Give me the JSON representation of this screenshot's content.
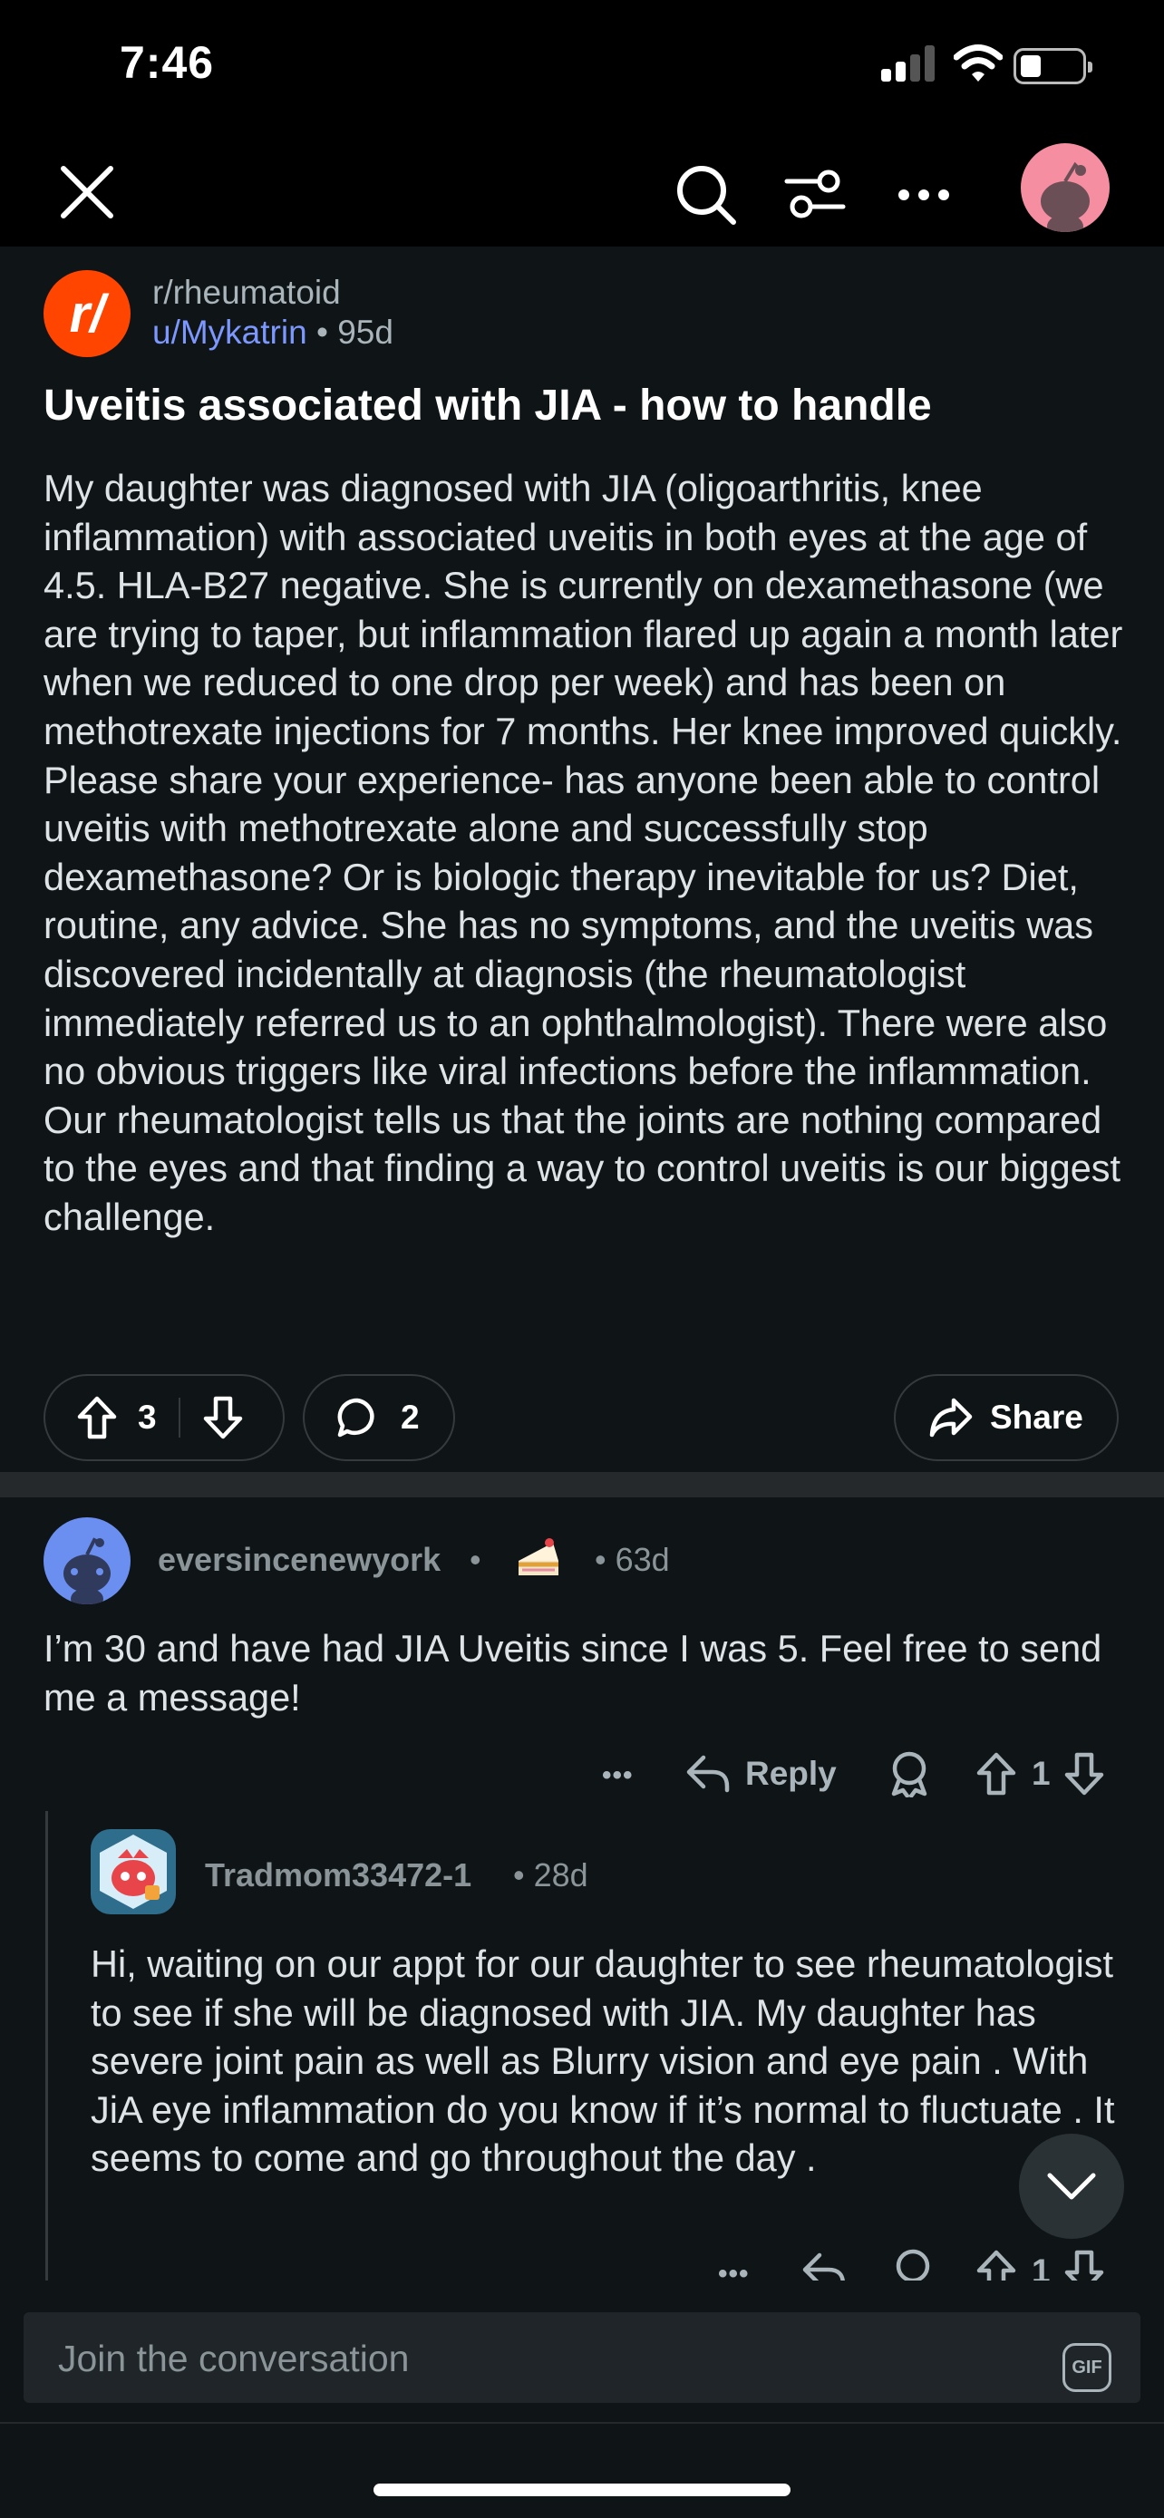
{
  "status_bar": {
    "time": "7:46"
  },
  "post": {
    "subreddit": "r/rheumatoid",
    "subreddit_icon": "r/",
    "author": "u/Mykatrin",
    "separator": "•",
    "age": "95d",
    "title": "Uveitis associated with JIA - how to handle",
    "body": "My daughter was diagnosed with JIA (oligoarthritis, knee inflammation) with associated uveitis in both eyes at the age of 4.5. HLA-B27 negative. She is currently on dexamethasone (we are trying to taper, but inflammation flared up again a month later when we reduced to one drop per week) and has been on methotrexate injections for 7 months. Her knee improved quickly. Please share your experience- has anyone been able to control uveitis with methotrexate alone and successfully stop dexamethasone? Or is biologic therapy inevitable for us? Diet, routine, any advice. She has no symptoms, and the uveitis was discovered incidentally at diagnosis (the rheumatologist immediately referred us to an ophthalmologist). There were also no obvious triggers like viral infections before the inflammation. Our rheumatologist tells us that the joints are nothing compared to the eyes and that finding a way to control uveitis is our biggest challenge.",
    "upvotes": "3",
    "comments": "2",
    "share_label": "Share"
  },
  "comments": [
    {
      "author": "eversincenewyork",
      "dot": "•",
      "age": "• 63d",
      "body": "I’m 30 and have had JIA Uveitis since I was 5. Feel free to send me a message!",
      "actions": {
        "more": "•••",
        "reply": "Reply",
        "votes": "1"
      }
    },
    {
      "author": "Tradmom33472-1",
      "age": "• 28d",
      "body": "Hi,  waiting on our appt for our daughter to see rheumatologist to see if she will be diagnosed with JIA. My daughter has severe joint pain as well as Blurry vision and eye pain . With JiA eye inflammation do you know if it’s normal to fluctuate . It seems to come and go throughout the day .",
      "actions": {
        "more": "•••",
        "votes": "1"
      }
    }
  ],
  "composer": {
    "placeholder": "Join the conversation",
    "gif_label": "GIF"
  },
  "icons": [
    "close-icon",
    "search-icon",
    "filter-icon",
    "more-icon",
    "avatar",
    "upvote-icon",
    "downvote-icon",
    "comment-icon",
    "share-icon",
    "reply-icon",
    "award-icon",
    "chevron-down-icon",
    "cake-icon"
  ],
  "colors": {
    "background": "#000000",
    "surface": "#0f1416",
    "subreddit_brand": "#ff4500",
    "user_link": "#7c98ff",
    "muted_text": "#8a9499"
  }
}
